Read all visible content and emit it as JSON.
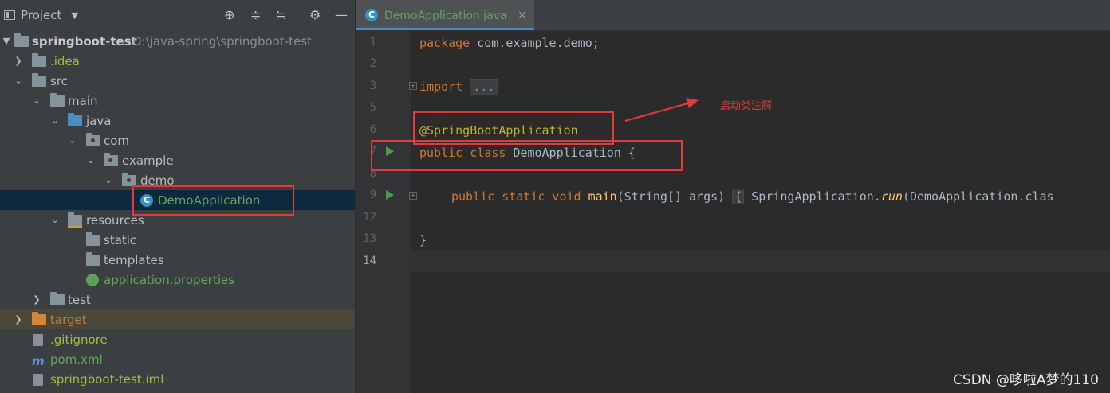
{
  "project_panel": {
    "title": "Project",
    "tree": [
      {
        "label": "springboot-test",
        "path": "D:\\java-spring\\springboot-test"
      },
      {
        "label": ".idea"
      },
      {
        "label": "src"
      },
      {
        "label": "main"
      },
      {
        "label": "java"
      },
      {
        "label": "com"
      },
      {
        "label": "example"
      },
      {
        "label": "demo"
      },
      {
        "label": "DemoApplication"
      },
      {
        "label": "resources"
      },
      {
        "label": "static"
      },
      {
        "label": "templates"
      },
      {
        "label": "application.properties"
      },
      {
        "label": "test"
      },
      {
        "label": "target"
      },
      {
        "label": ".gitignore"
      },
      {
        "label": "pom.xml"
      },
      {
        "label": "springboot-test.iml"
      }
    ]
  },
  "editor": {
    "tab": {
      "label": "DemoApplication.java",
      "close": "×"
    },
    "line_numbers": [
      "1",
      "2",
      "3",
      "5",
      "6",
      "7",
      "8",
      "9",
      "12",
      "13",
      "14"
    ],
    "code": {
      "l1_kw": "package",
      "l1_rest": " com.example.demo;",
      "l3_kw": "import",
      "l3_fold": "...",
      "l6_ann": "@SpringBootApplication",
      "l7_kw": "public class",
      "l7_rest": " DemoApplication {",
      "l9_kw": "public static void",
      "l9_fn": "main",
      "l9_args": "(String[] args) ",
      "l9_brace": "{",
      "l9_call": " SpringApplication.",
      "l9_run": "run",
      "l9_tail": "(DemoApplication.clas",
      "l13": "}"
    }
  },
  "annotation_note": "启动类注解",
  "watermark": "CSDN @哆啦A梦的110",
  "colors": {
    "keyword": "#cc7832",
    "annotation": "#bbb529",
    "highlight": "#e23b3b"
  }
}
